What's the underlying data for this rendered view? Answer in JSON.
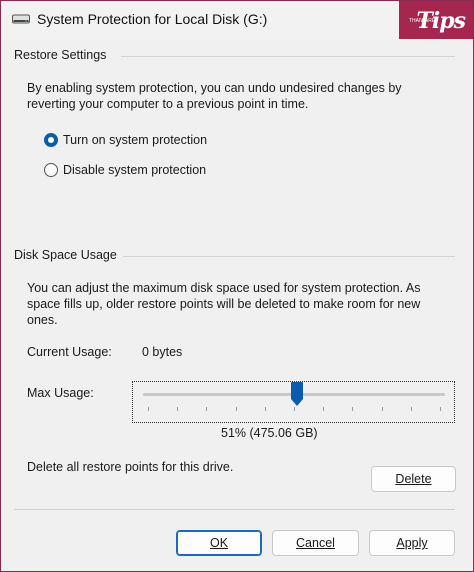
{
  "window": {
    "title": "System Protection for Local Disk (G:)",
    "logo_text": "Tips",
    "logo_small": "THAIWARE"
  },
  "restore_settings": {
    "header": "Restore Settings",
    "description": "By enabling system protection, you can undo undesired changes by reverting your computer to a previous point in time.",
    "options": [
      {
        "label": "Turn on system protection",
        "selected": true
      },
      {
        "label": "Disable system protection",
        "selected": false
      }
    ]
  },
  "disk_space": {
    "header": "Disk Space Usage",
    "description": "You can adjust the maximum disk space used for system protection. As space fills up, older restore points will be deleted to make room for new ones.",
    "current_usage_label": "Current Usage:",
    "current_usage_value": "0 bytes",
    "max_usage_label": "Max Usage:",
    "max_usage_percent": 51,
    "max_usage_text": "51% (475.06 GB)",
    "delete_text": "Delete all restore points for this drive.",
    "delete_button": "Delete"
  },
  "buttons": {
    "ok": "OK",
    "cancel": "Cancel",
    "apply": "Apply"
  },
  "colors": {
    "accent": "#0b5cad",
    "titlebar_accent": "#a5264f"
  }
}
